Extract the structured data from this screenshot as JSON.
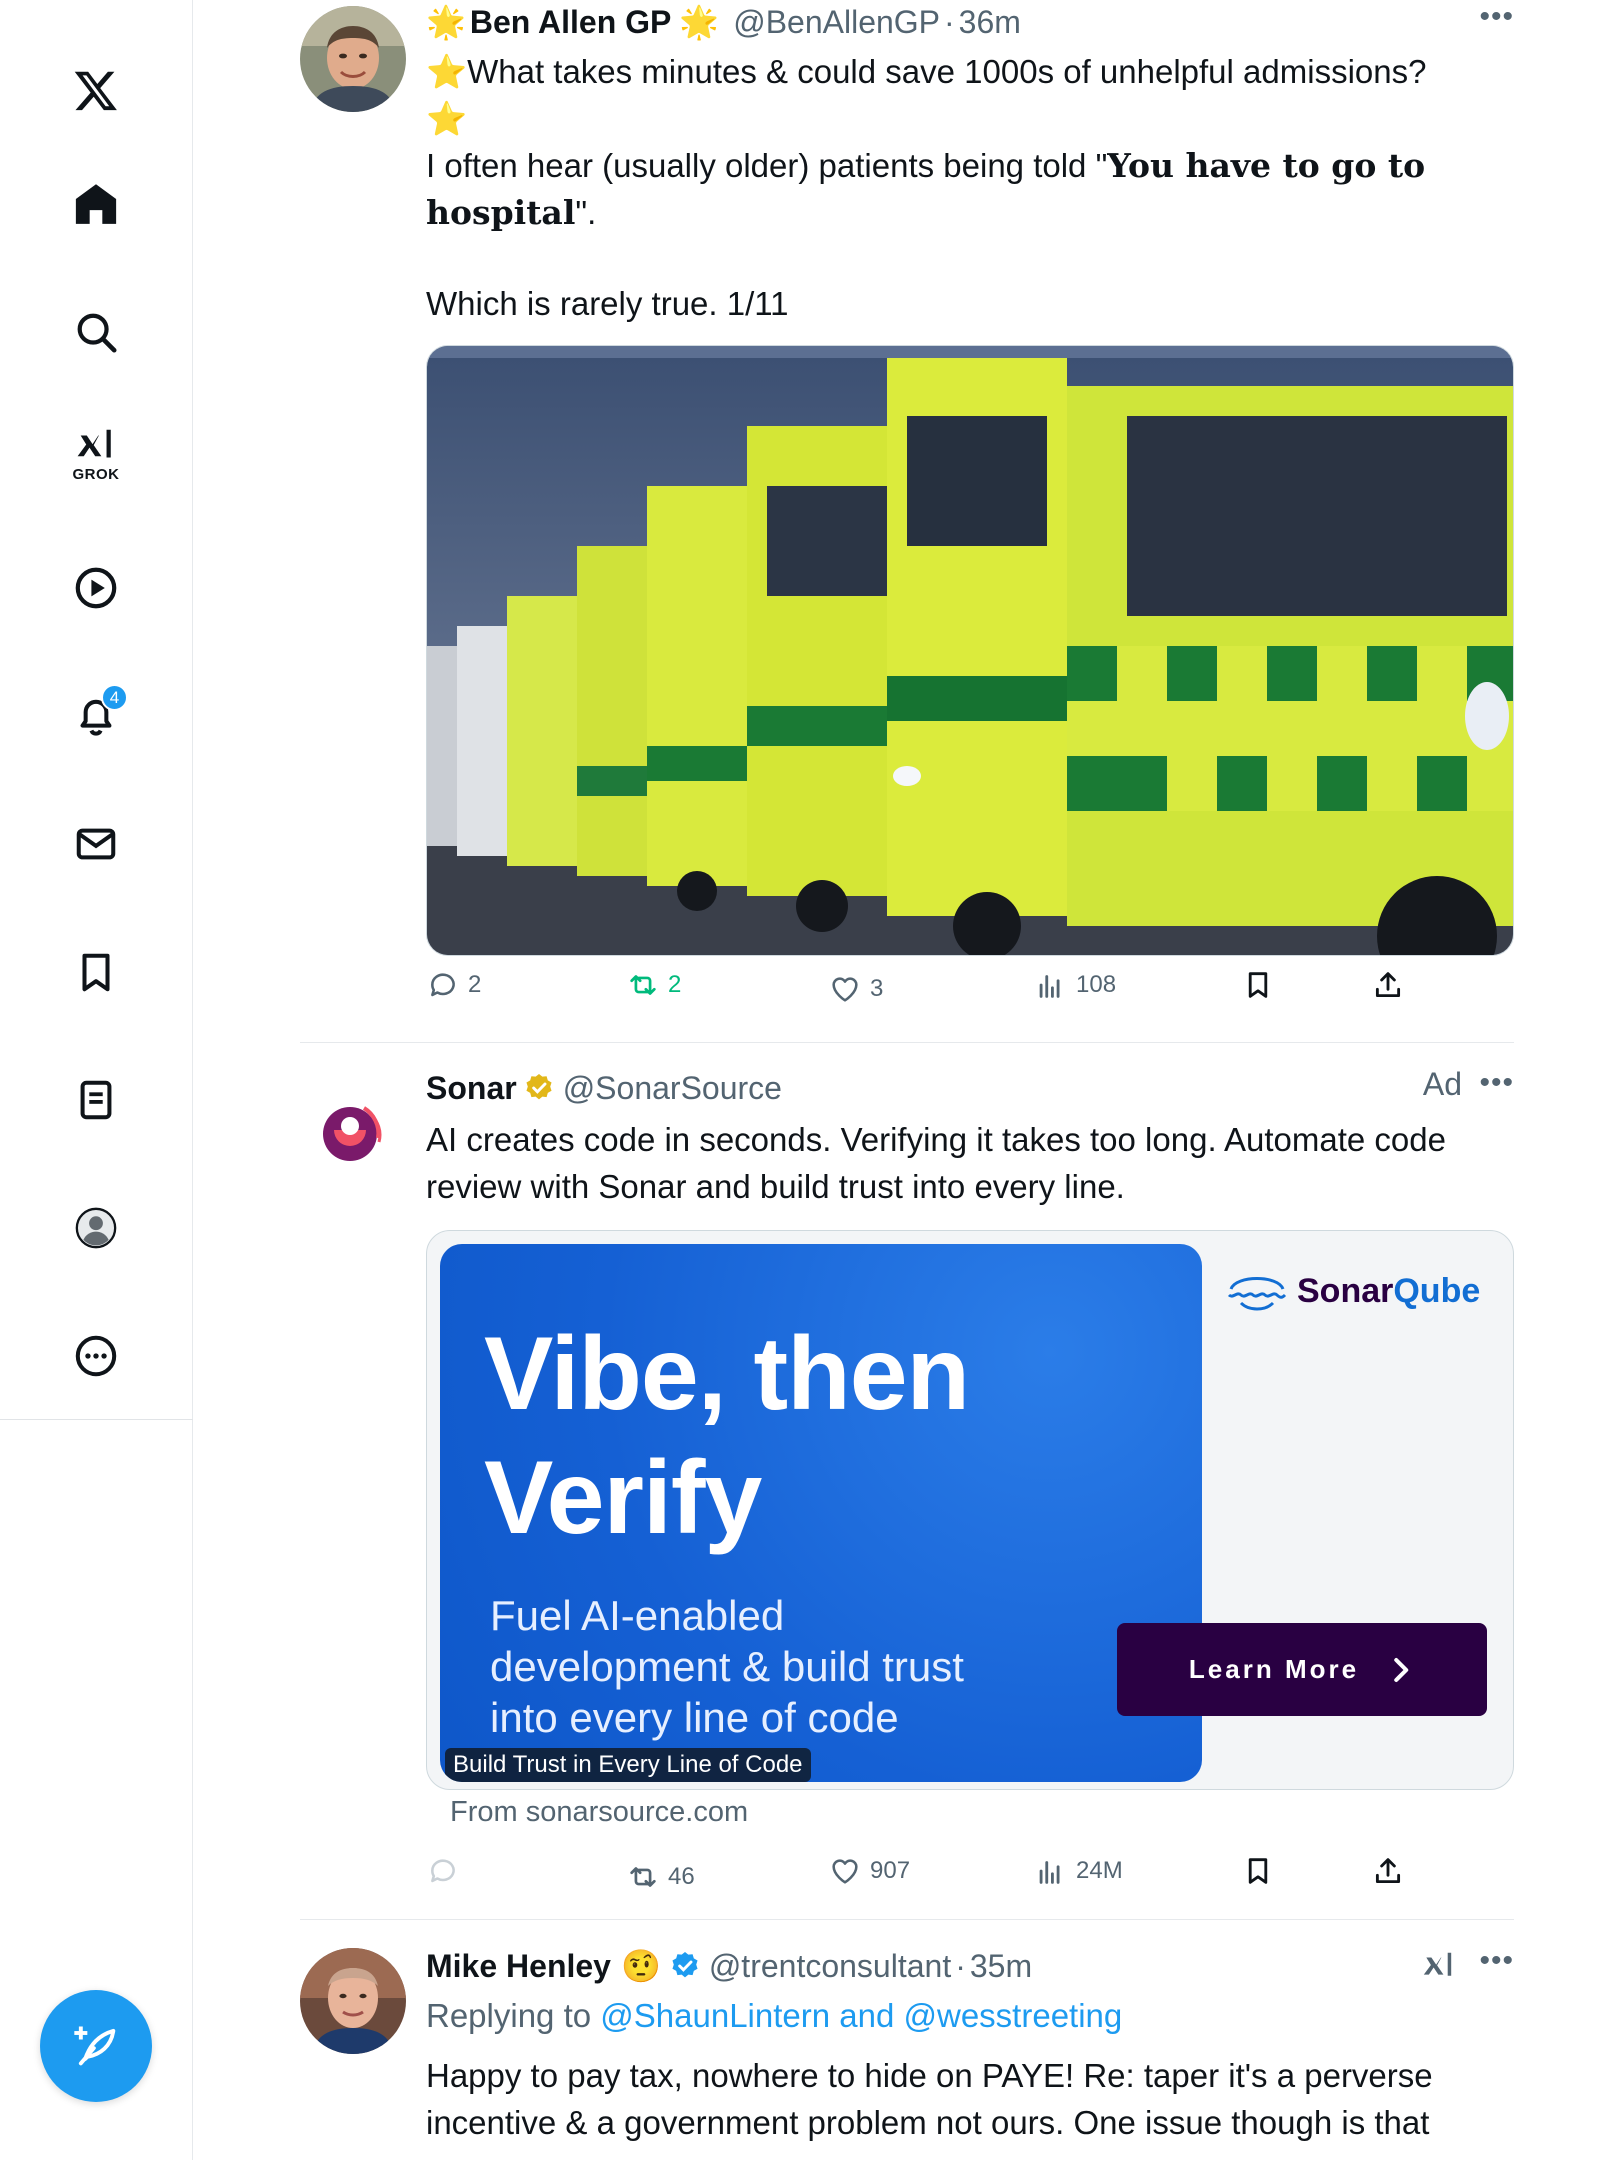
{
  "nav": {
    "grok_label": "GROK",
    "notifications_badge": "4",
    "items": [
      "x-logo-icon",
      "home-icon",
      "search-icon",
      "grok-icon",
      "video-icon",
      "bell-icon",
      "mail-icon",
      "bookmark-icon",
      "list-icon",
      "profile-icon",
      "more-circle-icon"
    ]
  },
  "post1": {
    "name": "Ben Allen GP",
    "name_prefix_emoji": "🌟",
    "name_suffix_emoji": "🌟",
    "handle": "@BenAllenGP",
    "dot": "·",
    "time": "36m",
    "line1": "⭐What takes minutes & could save 1000s of unhelpful admissions?",
    "line2": "⭐",
    "line3_a": "I often hear (usually older) patients being told \"",
    "line3_bold": "You have to go to",
    "line4_bold": "hospital",
    "line4_b": "\".",
    "line5": "Which is rarely true. 1/11",
    "replies": "2",
    "reposts": "2",
    "likes": "3",
    "views": "108"
  },
  "post2": {
    "name": "Sonar",
    "handle": "@SonarSource",
    "ad_label": "Ad",
    "text1": "AI creates code in seconds. Verifying it takes too long. Automate code",
    "text2": "review with Sonar and build trust into every line.",
    "card": {
      "headline1": "Vibe, then",
      "headline2": "Verify",
      "sub1": "Fuel AI-enabled",
      "sub2": "development & build trust",
      "sub3": "into every line of code",
      "caption": "Build Trust in Every Line of Code",
      "logo_sonar": "Sonar",
      "logo_qube": "Qube",
      "cta": "Learn More"
    },
    "from": "From sonarsource.com",
    "reposts": "46",
    "likes": "907",
    "views": "24M"
  },
  "post3": {
    "name": "Mike Henley",
    "emoji": "🤨",
    "handle": "@trentconsultant",
    "dot": "·",
    "time": "35m",
    "replying_to": "Replying to",
    "reply_handles": "@ShaunLintern and @wesstreeting",
    "text1": "Happy to pay tax, nowhere to hide on PAYE! Re: taper it's a perverse",
    "text2": "incentive & a government problem not ours. One issue though is that"
  },
  "colors": {
    "accent": "#1d9bf0",
    "repost_green": "#00ba7c",
    "sonar_purple": "#290042",
    "ad_blue": "#1560d4"
  }
}
